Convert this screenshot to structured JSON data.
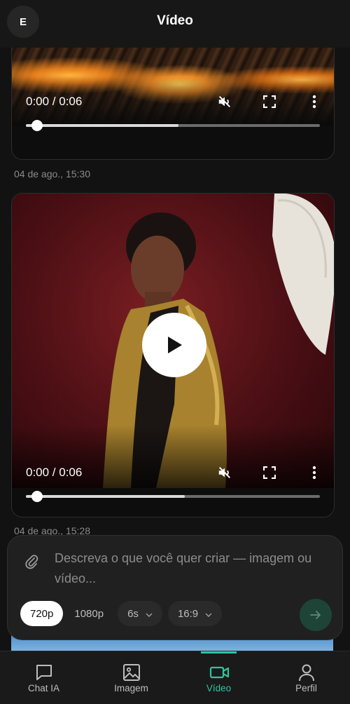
{
  "header": {
    "avatar_initial": "E",
    "title": "Vídeo"
  },
  "feed": {
    "videos": [
      {
        "time_display": "0:00 / 0:06",
        "progress": 0.52,
        "muted": true,
        "timestamp": "04 de ago., 15:30"
      },
      {
        "time_display": "0:00 / 0:06",
        "progress": 0.54,
        "muted": true,
        "timestamp": "04 de ago., 15:28"
      }
    ]
  },
  "composer": {
    "placeholder": "Descreva o que você quer criar — imagem ou vídeo...",
    "resolution_options": [
      "720p",
      "1080p"
    ],
    "selected_resolution": "720p",
    "duration": "6s",
    "aspect_ratio": "16:9"
  },
  "bottom_nav": {
    "items": [
      {
        "label": "Chat IA",
        "icon": "chat-icon",
        "active": false
      },
      {
        "label": "Imagem",
        "icon": "image-icon",
        "active": false
      },
      {
        "label": "Vídeo",
        "icon": "video-camera-icon",
        "active": true
      },
      {
        "label": "Perfil",
        "icon": "user-icon",
        "active": false
      }
    ]
  },
  "colors": {
    "accent": "#2ec4a0",
    "background": "#121212",
    "surface": "#202020"
  }
}
